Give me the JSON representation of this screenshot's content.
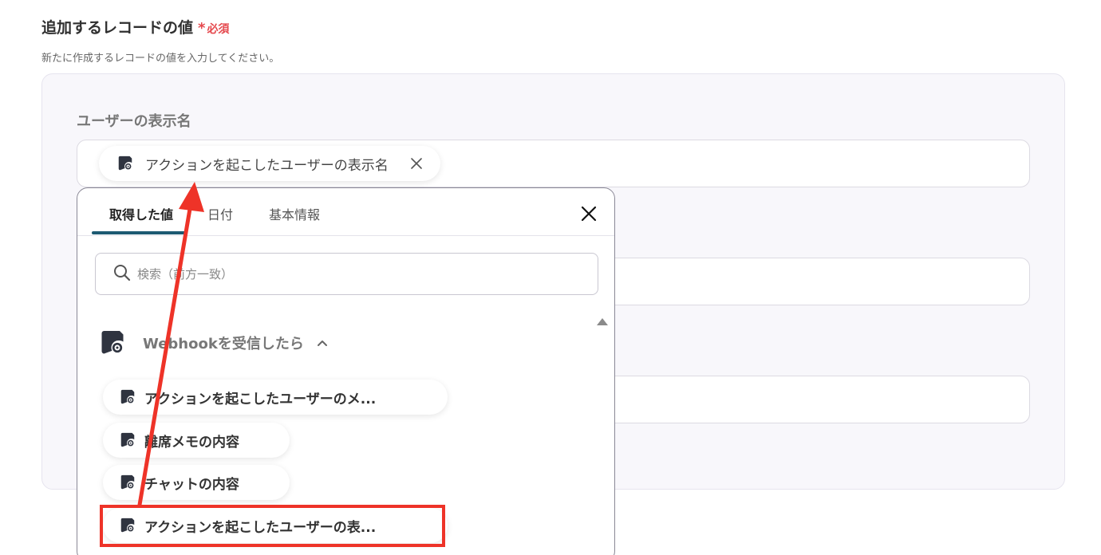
{
  "section": {
    "title": "追加するレコードの値",
    "required_star": "*",
    "required_label": "必須",
    "description": "新たに作成するレコードの値を入力してください。"
  },
  "form": {
    "field_label": "ユーザーの表示名",
    "selected_token": {
      "label": "アクションを起こしたユーザーの表示名",
      "icon": "webhook-icon"
    }
  },
  "popup": {
    "tabs": [
      {
        "label": "取得した値",
        "active": true
      },
      {
        "label": "日付",
        "active": false
      },
      {
        "label": "基本情報",
        "active": false
      }
    ],
    "search_placeholder": "検索（前方一致）",
    "group": {
      "label": "Webhookを受信したら",
      "expanded": true,
      "items": [
        {
          "label": "アクションを起こしたユーザーのメ..."
        },
        {
          "label": "離席メモの内容"
        },
        {
          "label": "チャットの内容"
        },
        {
          "label": "アクションを起こしたユーザーの表..."
        }
      ]
    }
  },
  "annotation": {
    "highlight_color": "#ee3328"
  }
}
